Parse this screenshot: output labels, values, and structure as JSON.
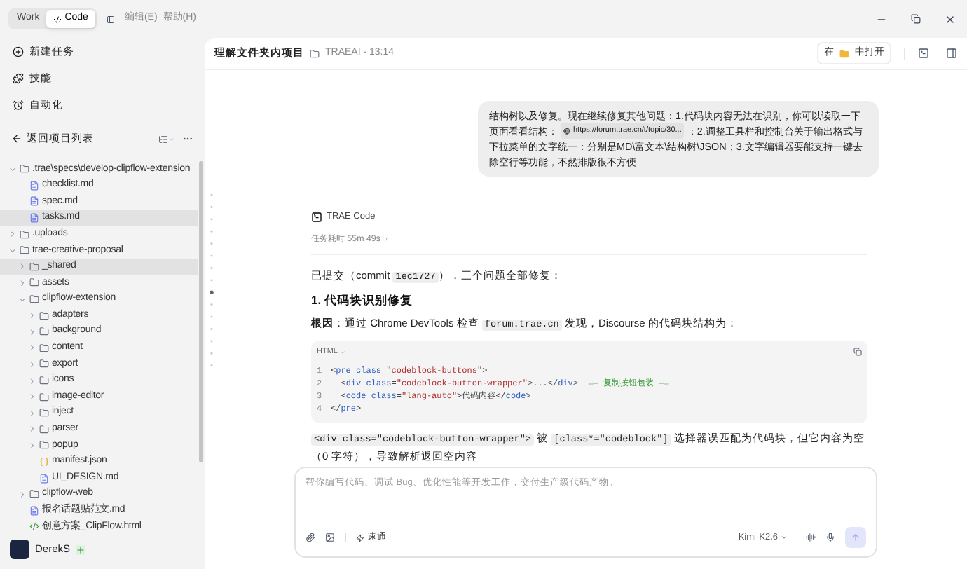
{
  "mode_switch": [
    {
      "label": "Work",
      "selected": false
    },
    {
      "label": "Code",
      "selected": true
    }
  ],
  "menu": [
    "编辑(E)",
    "帮助(H)"
  ],
  "sidebar": {
    "actions": [
      {
        "kind": "new",
        "label": "新建任务"
      },
      {
        "kind": "skills",
        "label": "技能"
      },
      {
        "kind": "auto",
        "label": "自动化"
      }
    ],
    "back": "返回项目列表",
    "tree": [
      {
        "label": ".trae\\specs\\develop-clipflow-extension",
        "kind": "folder",
        "expanded": true,
        "selected": false,
        "children": [
          {
            "label": "checklist.md",
            "kind": "md",
            "selected": false
          },
          {
            "label": "spec.md",
            "kind": "md",
            "selected": false
          },
          {
            "label": "tasks.md",
            "kind": "md",
            "selected": true
          }
        ]
      },
      {
        "label": ".uploads",
        "kind": "folder",
        "expanded": false,
        "selected": false
      },
      {
        "label": "trae-creative-proposal",
        "kind": "folder",
        "expanded": true,
        "selected": false,
        "children": [
          {
            "label": "_shared",
            "kind": "folder",
            "expanded": false,
            "selected": true
          },
          {
            "label": "assets",
            "kind": "folder",
            "expanded": false,
            "selected": false
          },
          {
            "label": "clipflow-extension",
            "kind": "folder",
            "expanded": true,
            "selected": false,
            "children": [
              {
                "label": "adapters",
                "kind": "folder",
                "expanded": false,
                "selected": false
              },
              {
                "label": "background",
                "kind": "folder",
                "expanded": false,
                "selected": false
              },
              {
                "label": "content",
                "kind": "folder",
                "expanded": false,
                "selected": false
              },
              {
                "label": "export",
                "kind": "folder",
                "expanded": false,
                "selected": false
              },
              {
                "label": "icons",
                "kind": "folder",
                "expanded": false,
                "selected": false
              },
              {
                "label": "image-editor",
                "kind": "folder",
                "expanded": false,
                "selected": false
              },
              {
                "label": "inject",
                "kind": "folder",
                "expanded": false,
                "selected": false
              },
              {
                "label": "parser",
                "kind": "folder",
                "expanded": false,
                "selected": false
              },
              {
                "label": "popup",
                "kind": "folder",
                "expanded": false,
                "selected": false
              },
              {
                "label": "manifest.json",
                "kind": "json",
                "selected": false
              },
              {
                "label": "UI_DESIGN.md",
                "kind": "md",
                "selected": false
              }
            ]
          },
          {
            "label": "clipflow-web",
            "kind": "folder",
            "expanded": false,
            "selected": false
          },
          {
            "label": "报名话题贴范文.md",
            "kind": "md",
            "selected": false
          },
          {
            "label": "创意方案_ClipFlow.html",
            "kind": "html",
            "selected": false
          }
        ]
      }
    ],
    "user": {
      "name": "DerekS"
    }
  },
  "header": {
    "title": "理解文件夹内项目",
    "project": "TRAEAI - 13:14",
    "open_in": [
      "在",
      "中打开"
    ]
  },
  "user_message": {
    "before": "结构树以及修复。现在继续修复其他问题：1.代码块内容无法在识别，你可以读取一下页面看看结构：",
    "link": "https://forum.trae.cn/t/topic/30...",
    "after": "；2.调整工具栏和控制台关于输出格式与下拉菜单的文字统一：分别是MD\\富文本\\结构树\\JSON；3.文字编辑器要能支持一键去除空行等功能，不然排版很不方便"
  },
  "reply": {
    "agent": "TRAE Code",
    "duration": "任务耗时 55m 49s",
    "blocks": [
      {
        "kind": "p",
        "segments": [
          {
            "kind": "text",
            "text": "已提交（commit "
          },
          {
            "kind": "code",
            "text": "1ec1727"
          },
          {
            "kind": "text",
            "text": "），三个问题全部修复："
          }
        ]
      },
      {
        "kind": "h",
        "segments": [
          {
            "kind": "text",
            "text": "1. 代码块识别修复"
          }
        ]
      },
      {
        "kind": "p",
        "segments": [
          {
            "kind": "text",
            "text": "**根因**：通过 Chrome DevTools 检查 "
          },
          {
            "kind": "code",
            "text": "forum.trae.cn"
          },
          {
            "kind": "text",
            "text": " 发现，Discourse 的代码块结构为："
          }
        ]
      },
      {
        "kind": "codeblock",
        "language": "HTML",
        "line_numbers": [
          "1",
          "2",
          "3",
          "4"
        ],
        "lines": [
          [
            {
              "kind": "punct",
              "text": "<"
            },
            {
              "kind": "tag",
              "text": "pre"
            },
            {
              "kind": "attr",
              "text": " class"
            },
            {
              "kind": "punct",
              "text": "="
            },
            {
              "kind": "str",
              "text": "\"codeblock-buttons\""
            },
            {
              "kind": "punct",
              "text": ">"
            }
          ],
          [
            {
              "kind": "punct",
              "text": "  <"
            },
            {
              "kind": "tag",
              "text": "div"
            },
            {
              "kind": "attr",
              "text": " class"
            },
            {
              "kind": "punct",
              "text": "="
            },
            {
              "kind": "str",
              "text": "\"codeblock-button-wrapper\""
            },
            {
              "kind": "punct",
              "text": ">...</"
            },
            {
              "kind": "tag",
              "text": "div"
            },
            {
              "kind": "punct",
              "text": ">  "
            },
            {
              "kind": "comment",
              "text": "←— 复制按钮包装 —→"
            }
          ],
          [
            {
              "kind": "punct",
              "text": "  <"
            },
            {
              "kind": "tag",
              "text": "code"
            },
            {
              "kind": "attr",
              "text": " class"
            },
            {
              "kind": "punct",
              "text": "="
            },
            {
              "kind": "str",
              "text": "\"lang-auto\""
            },
            {
              "kind": "punct",
              "text": ">代码内容</"
            },
            {
              "kind": "tag",
              "text": "code"
            },
            {
              "kind": "punct",
              "text": ">"
            }
          ],
          [
            {
              "kind": "punct",
              "text": "</"
            },
            {
              "kind": "tag",
              "text": "pre"
            },
            {
              "kind": "punct",
              "text": ">"
            }
          ]
        ]
      },
      {
        "kind": "p",
        "segments": [
          {
            "kind": "code",
            "text": "<div class=\"codeblock-button-wrapper\">"
          },
          {
            "kind": "text",
            "text": " 被 "
          },
          {
            "kind": "code",
            "text": "[class*=\"codeblock\"]"
          },
          {
            "kind": "text",
            "text": " 选择器误匹配为代码块，但它内容为空（0 字符），导致解析返回空内容"
          }
        ]
      }
    ]
  },
  "composer": {
    "placeholder": "帮你编写代码、调试 Bug、优化性能等开发工作，交付生产级代码产物。",
    "mode": "速通",
    "model": "Kimi-K2.6"
  }
}
